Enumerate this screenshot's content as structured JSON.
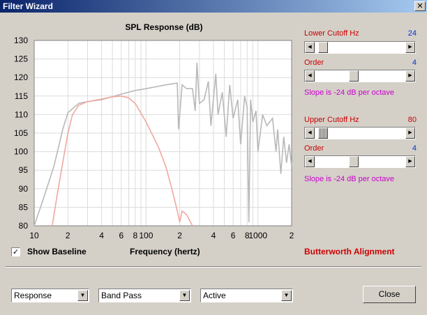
{
  "window": {
    "title": "Filter Wizard",
    "close_glyph": "✕"
  },
  "chart_data": {
    "type": "line",
    "title": "SPL Response (dB)",
    "xlabel": "Frequency (hertz)",
    "ylabel": "",
    "x_scale": "log",
    "xlim": [
      10,
      2000
    ],
    "ylim": [
      80,
      130
    ],
    "yticks": [
      "130",
      "125",
      "120",
      "115",
      "110",
      "105",
      "100",
      "95",
      "90",
      "85",
      "80"
    ],
    "xticks": [
      {
        "value": 10,
        "label": "10"
      },
      {
        "value": 20,
        "label": "2"
      },
      {
        "value": 40,
        "label": "4"
      },
      {
        "value": 60,
        "label": "6"
      },
      {
        "value": 80,
        "label": "8"
      },
      {
        "value": 100,
        "label": "100"
      },
      {
        "value": 200,
        "label": "2"
      },
      {
        "value": 400,
        "label": "4"
      },
      {
        "value": 600,
        "label": "6"
      },
      {
        "value": 800,
        "label": "8"
      },
      {
        "value": 1000,
        "label": "1000"
      },
      {
        "value": 2000,
        "label": "2"
      }
    ],
    "grid": true,
    "series": [
      {
        "color": "#b8b8b8",
        "points": [
          [
            10,
            80
          ],
          [
            12,
            87
          ],
          [
            15,
            96
          ],
          [
            18,
            106
          ],
          [
            20,
            110.5
          ],
          [
            25,
            113
          ],
          [
            30,
            113.5
          ],
          [
            40,
            114
          ],
          [
            60,
            115.5
          ],
          [
            80,
            116.5
          ],
          [
            100,
            117
          ],
          [
            150,
            118
          ],
          [
            190,
            118.5
          ],
          [
            195,
            106
          ],
          [
            210,
            118
          ],
          [
            230,
            117
          ],
          [
            260,
            117
          ],
          [
            275,
            111
          ],
          [
            285,
            124
          ],
          [
            295,
            116
          ],
          [
            300,
            113
          ],
          [
            330,
            114
          ],
          [
            360,
            119
          ],
          [
            380,
            107
          ],
          [
            420,
            121
          ],
          [
            440,
            110
          ],
          [
            480,
            116
          ],
          [
            520,
            104
          ],
          [
            560,
            118
          ],
          [
            600,
            109
          ],
          [
            660,
            114
          ],
          [
            700,
            102
          ],
          [
            760,
            115
          ],
          [
            800,
            112
          ],
          [
            830,
            81
          ],
          [
            860,
            114
          ],
          [
            900,
            108
          ],
          [
            960,
            111
          ],
          [
            1000,
            100
          ],
          [
            1100,
            110
          ],
          [
            1200,
            107
          ],
          [
            1350,
            109
          ],
          [
            1450,
            100
          ],
          [
            1500,
            106
          ],
          [
            1600,
            94
          ],
          [
            1700,
            104
          ],
          [
            1800,
            97
          ],
          [
            1900,
            102
          ],
          [
            2000,
            96
          ]
        ]
      },
      {
        "color": "#f0a8a0",
        "points": [
          [
            14.5,
            80
          ],
          [
            16,
            88
          ],
          [
            18,
            97
          ],
          [
            20,
            105
          ],
          [
            22,
            110
          ],
          [
            25,
            112.5
          ],
          [
            30,
            113.5
          ],
          [
            40,
            114.2
          ],
          [
            50,
            114.8
          ],
          [
            60,
            115
          ],
          [
            70,
            114.5
          ],
          [
            80,
            113
          ],
          [
            100,
            108
          ],
          [
            130,
            101
          ],
          [
            150,
            96
          ],
          [
            170,
            90
          ],
          [
            190,
            84
          ],
          [
            200,
            81
          ],
          [
            210,
            84
          ],
          [
            230,
            83
          ],
          [
            260,
            80
          ]
        ]
      }
    ]
  },
  "lower_cutoff": {
    "label": "Lower Cutoff  Hz",
    "value": "24",
    "fraction": 0.04
  },
  "lower_order": {
    "label": "Order",
    "value": "4",
    "fraction": 0.42
  },
  "lower_slope": "Slope is -24 dB per octave",
  "upper_cutoff": {
    "label": "Upper Cutoff  Hz",
    "value": "80",
    "fraction": 0.04
  },
  "upper_order": {
    "label": "Order",
    "value": "4",
    "fraction": 0.42
  },
  "upper_slope": "Slope is -24 dB per octave",
  "baseline": {
    "label": "Show Baseline",
    "checked": true,
    "check_glyph": "✓"
  },
  "alignment": "Butterworth Alignment",
  "dropdowns": [
    {
      "value": "Response"
    },
    {
      "value": "Band Pass"
    },
    {
      "value": "Active"
    }
  ],
  "dropdown_glyph": "▼",
  "slider_left_glyph": "◀",
  "slider_right_glyph": "▶",
  "close_button": "Close"
}
